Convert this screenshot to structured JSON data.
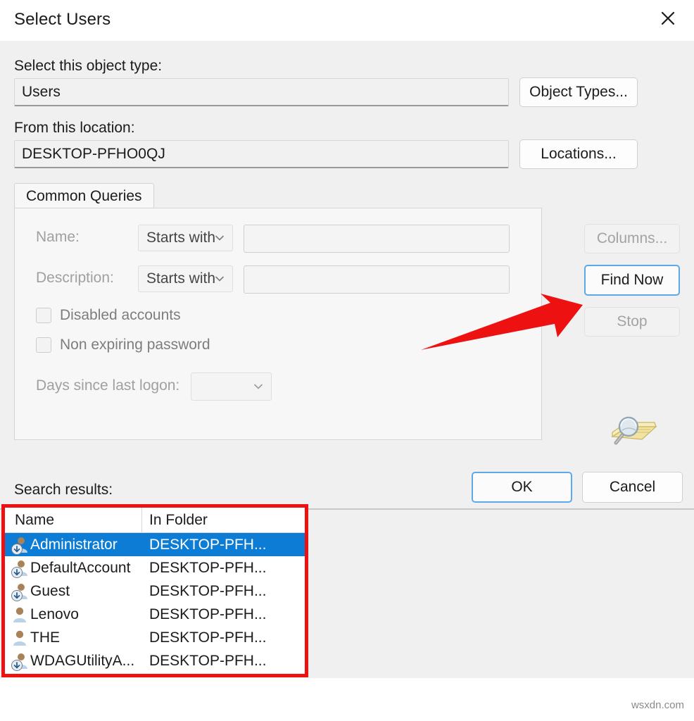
{
  "window": {
    "title": "Select Users",
    "close_label": "✕"
  },
  "object_type": {
    "label": "Select this object type:",
    "value": "Users",
    "button_label": "Object Types..."
  },
  "location": {
    "label": "From this location:",
    "value": "DESKTOP-PFHO0QJ",
    "button_label": "Locations..."
  },
  "tabs": [
    {
      "label": "Common Queries",
      "active": true
    }
  ],
  "query": {
    "name_label": "Name:",
    "name_condition": "Starts with",
    "name_value": "",
    "name_placeholder": "",
    "description_label": "Description:",
    "description_condition": "Starts with",
    "description_value": "",
    "description_placeholder": "",
    "disabled_accounts_label": "Disabled accounts",
    "disabled_accounts_checked": false,
    "non_expiring_password_label": "Non expiring password",
    "non_expiring_password_checked": false,
    "days_since_logon_label": "Days since last logon:",
    "days_since_logon_value": ""
  },
  "side_buttons": {
    "columns_label": "Columns...",
    "columns_disabled": true,
    "find_now_label": "Find Now",
    "find_now_disabled": false,
    "stop_label": "Stop",
    "stop_disabled": true
  },
  "footer": {
    "ok_label": "OK",
    "cancel_label": "Cancel"
  },
  "results": {
    "label": "Search results:",
    "columns": [
      "Name",
      "In Folder"
    ],
    "rows": [
      {
        "name": "Administrator",
        "folder": "DESKTOP-PFH...",
        "selected": true,
        "badge": true
      },
      {
        "name": "DefaultAccount",
        "folder": "DESKTOP-PFH...",
        "selected": false,
        "badge": true
      },
      {
        "name": "Guest",
        "folder": "DESKTOP-PFH...",
        "selected": false,
        "badge": true
      },
      {
        "name": "Lenovo",
        "folder": "DESKTOP-PFH...",
        "selected": false,
        "badge": false
      },
      {
        "name": "THE",
        "folder": "DESKTOP-PFH...",
        "selected": false,
        "badge": false
      },
      {
        "name": "WDAGUtilityA...",
        "folder": "DESKTOP-PFH...",
        "selected": false,
        "badge": true
      }
    ]
  },
  "annotation": {
    "arrow_color": "#ee1111",
    "highlight_color": "#ee1111",
    "points_to": "Find Now"
  },
  "colors": {
    "selection_blue": "#0c7cd5",
    "dialog_bg": "#f0f0f0",
    "accent_focus": "#5da9e8"
  },
  "watermark": "wsxdn.com"
}
